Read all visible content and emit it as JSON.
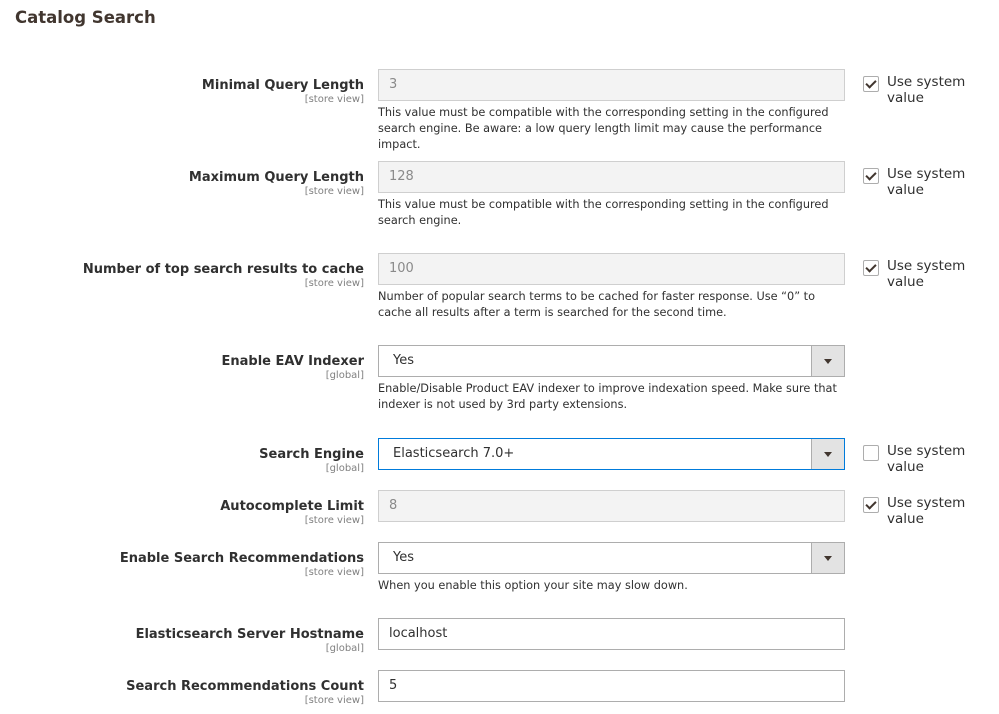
{
  "title": "Catalog Search",
  "rows": [
    {
      "label": "Minimal Query Length",
      "scope": "[store view]",
      "value": "3",
      "note": "This value must be compatible with the corresponding setting in the configured search engine. Be aware: a low query length limit may cause the performance impact.",
      "use_system": true
    },
    {
      "label": "Maximum Query Length",
      "scope": "[store view]",
      "value": "128",
      "note": "This value must be compatible with the corresponding setting in the configured search engine.",
      "use_system": true
    },
    {
      "label": "Number of top search results to cache",
      "scope": "[store view]",
      "value": "100",
      "note": "Number of popular search terms to be cached for faster response. Use “0” to cache all results after a term is searched for the second time.",
      "use_system": true
    },
    {
      "label": "Enable EAV Indexer",
      "scope": "[global]",
      "value": "Yes",
      "note": "Enable/Disable Product EAV indexer to improve indexation speed. Make sure that indexer is not used by 3rd party extensions."
    },
    {
      "label": "Search Engine",
      "scope": "[global]",
      "value": "Elasticsearch 7.0+",
      "use_system": false
    },
    {
      "label": "Autocomplete Limit",
      "scope": "[store view]",
      "value": "8",
      "use_system": true
    },
    {
      "label": "Enable Search Recommendations",
      "scope": "[store view]",
      "value": "Yes",
      "note": "When you enable this option your site may slow down."
    },
    {
      "label": "Elasticsearch Server Hostname",
      "scope": "[global]",
      "value": "localhost"
    },
    {
      "label": "Search Recommendations Count",
      "scope": "[store view]",
      "value": "5"
    }
  ],
  "use_system_label": "Use system value"
}
